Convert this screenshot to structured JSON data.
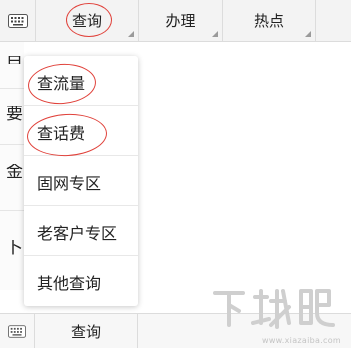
{
  "top_menu": {
    "keyboard_icon": "keyboard-icon",
    "tabs": [
      {
        "label": "查询"
      },
      {
        "label": "办理"
      },
      {
        "label": "热点"
      }
    ]
  },
  "background_page": {
    "partial_glyphs": [
      "目",
      "要",
      "金",
      "卜"
    ]
  },
  "dropdown": {
    "items": [
      {
        "label": "查流量"
      },
      {
        "label": "查话费"
      },
      {
        "label": "固网专区"
      },
      {
        "label": "老客户专区"
      },
      {
        "label": "其他查询"
      }
    ]
  },
  "bottom_bar": {
    "keyboard_icon": "keyboard-icon",
    "tab_label": "查询"
  },
  "watermark": {
    "logo_text": "下载吧",
    "url": "www.xiazaiba.com"
  },
  "colors": {
    "annotation_red": "#e0413a",
    "bar_bg": "#f3f3f3"
  }
}
